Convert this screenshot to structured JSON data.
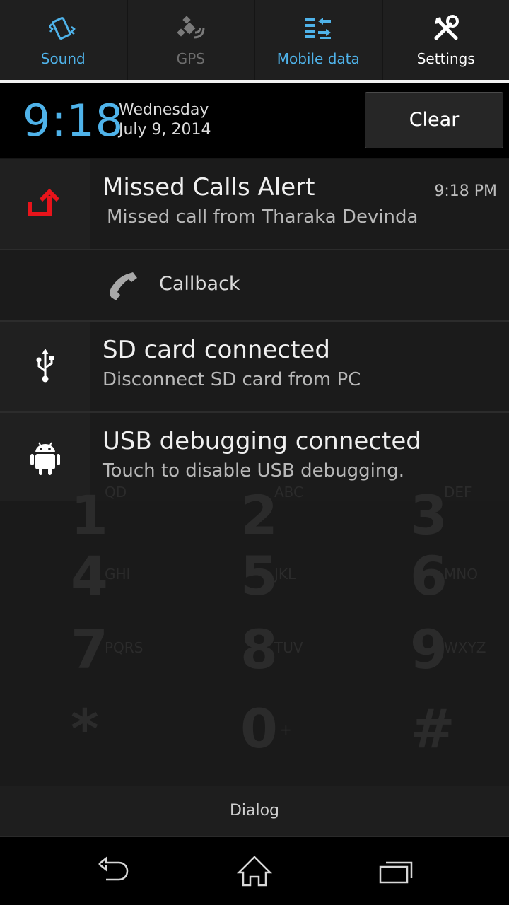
{
  "quick_settings": [
    {
      "label": "Sound",
      "icon": "vibrate-icon",
      "color": "#4fb3ea"
    },
    {
      "label": "GPS",
      "icon": "gps-satellite-icon",
      "color": "#6e6e6e"
    },
    {
      "label": "Mobile data",
      "icon": "mobile-data-icon",
      "color": "#4fb3ea"
    },
    {
      "label": "Settings",
      "icon": "tools-icon",
      "color": "#ffffff"
    }
  ],
  "header": {
    "time": "9:18",
    "day": "Wednesday",
    "date": "July 9, 2014",
    "clear_label": "Clear"
  },
  "notifications": {
    "missed_call": {
      "title": "Missed Calls Alert",
      "subtitle": "Missed call from Tharaka Devinda",
      "time": "9:18 PM",
      "icon": "missed-call-icon",
      "action_label": "Callback",
      "action_icon": "phone-handset-icon"
    },
    "sd_card": {
      "title": "SD card connected",
      "subtitle": "Disconnect SD card from PC",
      "icon": "usb-icon"
    },
    "usb_debug": {
      "title": "USB debugging connected",
      "subtitle": "Touch to disable USB debugging.",
      "icon": "android-icon"
    }
  },
  "dialpad": {
    "keys": [
      {
        "num": "1",
        "letters": "QD"
      },
      {
        "num": "2",
        "letters": "ABC"
      },
      {
        "num": "3",
        "letters": "DEF"
      },
      {
        "num": "4",
        "letters": "GHI"
      },
      {
        "num": "5",
        "letters": "JKL"
      },
      {
        "num": "6",
        "letters": "MNO"
      },
      {
        "num": "7",
        "letters": "PQRS"
      },
      {
        "num": "8",
        "letters": "TUV"
      },
      {
        "num": "9",
        "letters": "WXYZ"
      },
      {
        "num": "*",
        "letters": ""
      },
      {
        "num": "0",
        "letters": "+"
      },
      {
        "num": "#",
        "letters": ""
      }
    ]
  },
  "dialog_bar": {
    "label": "Dialog"
  },
  "nav": {
    "back_icon": "back-icon",
    "home_icon": "home-icon",
    "recents_icon": "recents-icon"
  },
  "colors": {
    "accent": "#4fb3ea",
    "missed_call": "#e8141b"
  }
}
